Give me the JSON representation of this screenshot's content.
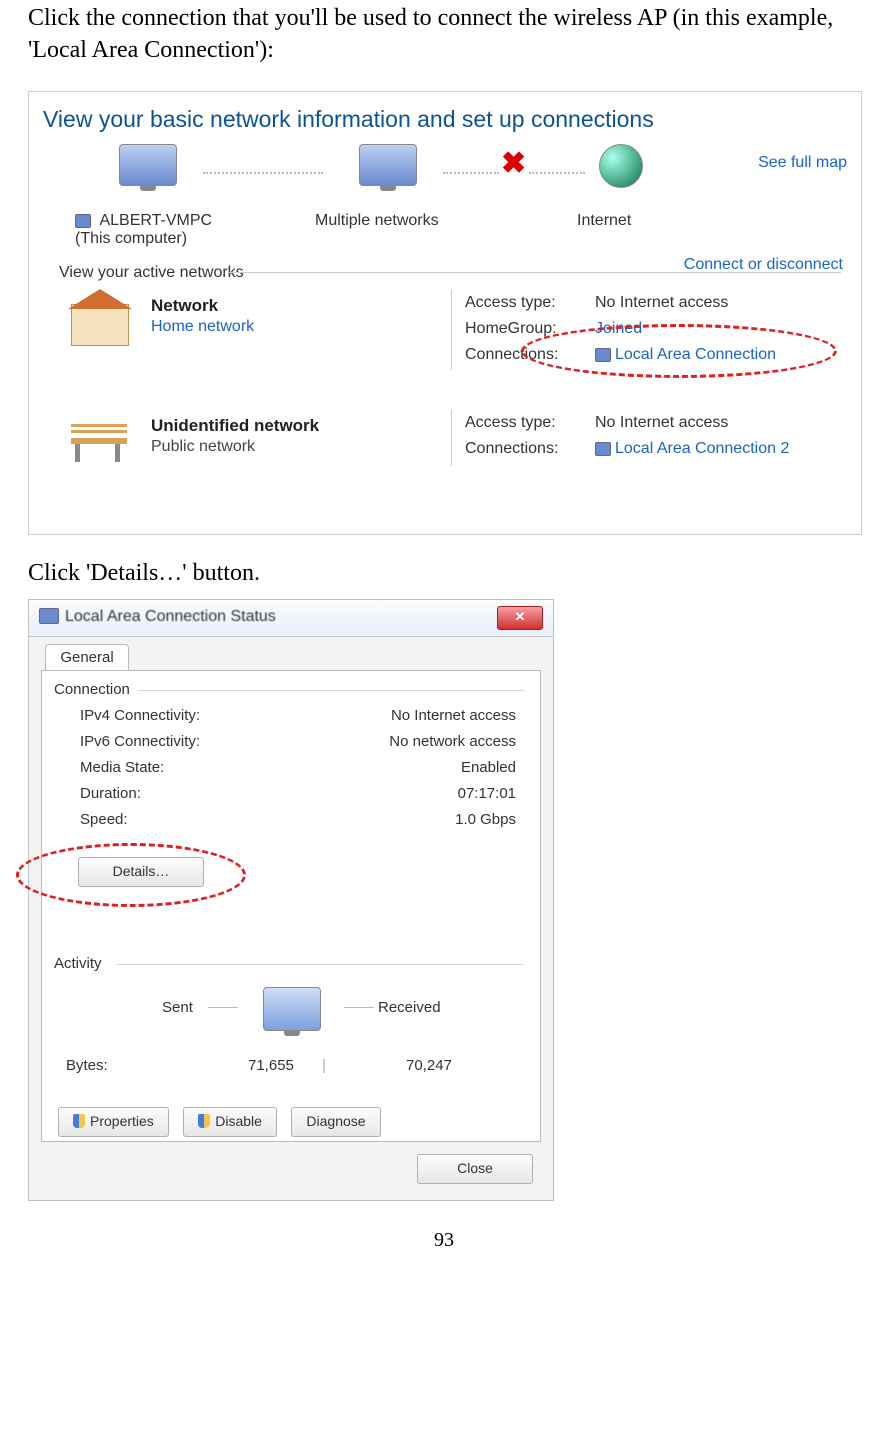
{
  "page_number": "93",
  "intro_text": "Click the connection that you'll be used to connect the wireless AP (in this example, 'Local Area Connection'):",
  "step2_text": "Click 'Details…' button.",
  "s1": {
    "title": "View your basic network information and set up connections",
    "full_map": "See full map",
    "node_pc": "ALBERT-VMPC",
    "node_pc_sub": "(This computer)",
    "node_mid": "Multiple networks",
    "node_net": "Internet",
    "active_label": "View your active networks",
    "connect_disconnect": "Connect or disconnect",
    "card1_title": "Network",
    "card1_sub": "Home network",
    "card2_title": "Unidentified network",
    "card2_sub": "Public network",
    "k_access": "Access type:",
    "k_homegroup": "HomeGroup:",
    "k_conn": "Connections:",
    "v_noaccess": "No Internet access",
    "v_joined": "Joined",
    "v_lan1": "Local Area Connection",
    "v_lan2": "Local Area Connection 2"
  },
  "s2": {
    "title": "Local Area Connection Status",
    "tab": "General",
    "group_conn": "Connection",
    "group_activity": "Activity",
    "rows": {
      "ipv4_k": "IPv4 Connectivity:",
      "ipv4_v": "No Internet access",
      "ipv6_k": "IPv6 Connectivity:",
      "ipv6_v": "No network access",
      "media_k": "Media State:",
      "media_v": "Enabled",
      "dur_k": "Duration:",
      "dur_v": "07:17:01",
      "speed_k": "Speed:",
      "speed_v": "1.0 Gbps"
    },
    "details_btn": "Details…",
    "sent": "Sent",
    "received": "Received",
    "bytes_label": "Bytes:",
    "bytes_sent": "71,655",
    "bytes_recv": "70,247",
    "btn_props": "Properties",
    "btn_disable": "Disable",
    "btn_diag": "Diagnose",
    "btn_close": "Close"
  }
}
